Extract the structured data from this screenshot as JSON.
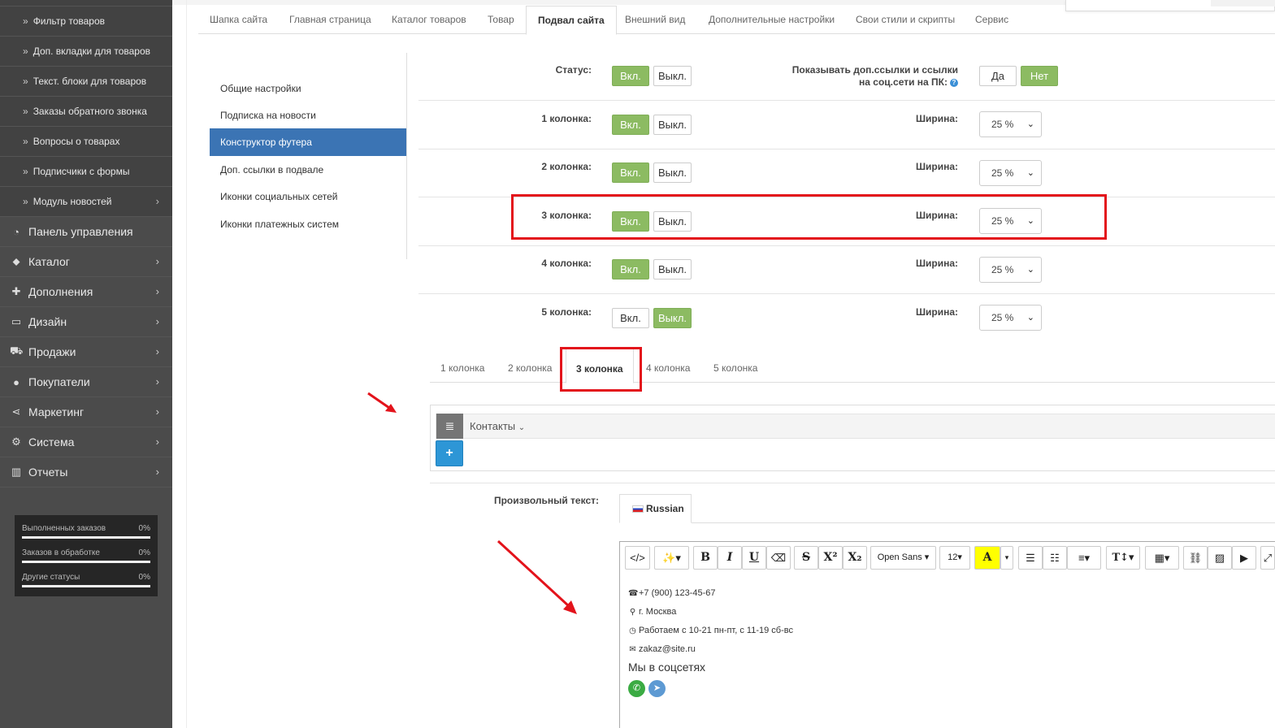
{
  "sidebar": {
    "sub_items": [
      {
        "label": "Фильтр товаров"
      },
      {
        "label": "Доп. вкладки для товаров"
      },
      {
        "label": "Текст. блоки для товаров"
      },
      {
        "label": "Заказы обратного звонка"
      },
      {
        "label": "Вопросы о товарах"
      },
      {
        "label": "Подписчики с формы"
      },
      {
        "label": "Модуль новостей"
      }
    ],
    "main_items": [
      {
        "label": "Панель управления",
        "icon": "dashboard-icon"
      },
      {
        "label": "Каталог",
        "icon": "tag-icon"
      },
      {
        "label": "Дополнения",
        "icon": "puzzle-icon"
      },
      {
        "label": "Дизайн",
        "icon": "desktop-icon"
      },
      {
        "label": "Продажи",
        "icon": "cart-icon"
      },
      {
        "label": "Покупатели",
        "icon": "user-icon"
      },
      {
        "label": "Маркетинг",
        "icon": "share-icon"
      },
      {
        "label": "Система",
        "icon": "gear-icon"
      },
      {
        "label": "Отчеты",
        "icon": "bar-chart-icon"
      }
    ],
    "stats": [
      {
        "label": "Выполненных заказов",
        "value": "0%"
      },
      {
        "label": "Заказов в обработке",
        "value": "0%"
      },
      {
        "label": "Другие статусы",
        "value": "0%"
      }
    ]
  },
  "top_tabs": [
    {
      "label": "Шапка сайта"
    },
    {
      "label": "Главная страница"
    },
    {
      "label": "Каталог товаров"
    },
    {
      "label": "Товар"
    },
    {
      "label": "Подвал сайта"
    },
    {
      "label": "Внешний вид"
    },
    {
      "label": "Дополнительные настройки"
    },
    {
      "label": "Свои стили и скрипты"
    },
    {
      "label": "Сервис"
    }
  ],
  "submenu": [
    {
      "label": "Общие настройки"
    },
    {
      "label": "Подписка на новости"
    },
    {
      "label": "Конструктор футера"
    },
    {
      "label": "Доп. ссылки в подвале"
    },
    {
      "label": "Иконки социальных сетей"
    },
    {
      "label": "Иконки платежных систем"
    }
  ],
  "settings": {
    "status_label": "Статус:",
    "on_label": "Вкл.",
    "off_label": "Выкл.",
    "show_links_label_1": "Показывать доп.ссылки и ссылки",
    "show_links_label_2": "на соц.сети на ПК:",
    "yes_label": "Да",
    "no_label": "Нет",
    "width_label": "Ширина:",
    "columns": [
      {
        "label": "1 колонка:",
        "enabled": true,
        "width": "25 %"
      },
      {
        "label": "2 колонка:",
        "enabled": true,
        "width": "25 %"
      },
      {
        "label": "3 колонка:",
        "enabled": true,
        "width": "25 %"
      },
      {
        "label": "4 колонка:",
        "enabled": true,
        "width": "25 %"
      },
      {
        "label": "5 колонка:",
        "enabled": false,
        "width": "25 %"
      }
    ]
  },
  "column_tabs": [
    {
      "label": "1 колонка"
    },
    {
      "label": "2 колонка"
    },
    {
      "label": "3 колонка"
    },
    {
      "label": "4 колонка"
    },
    {
      "label": "5 колонка"
    }
  ],
  "blocks": {
    "title": "Контакты",
    "add_label": "+"
  },
  "custom_text": {
    "label": "Произвольный текст:",
    "lang_tab": "Russian"
  },
  "editor": {
    "font_name": "Open Sans",
    "font_size": "12",
    "lines": [
      {
        "icon": "phone-icon",
        "text": "+7 (900) 123-45-67"
      },
      {
        "icon": "map-marker-icon",
        "text": "г. Москва"
      },
      {
        "icon": "clock-icon",
        "text": "Работаем с 10-21 пн-пт, с 11-19 сб-вс"
      },
      {
        "icon": "envelope-icon",
        "text": "zakaz@site.ru"
      }
    ],
    "social_heading": "Мы в соцсетях"
  },
  "colors": {
    "accent_green": "#8cbb62",
    "active_blue": "#3b74b4",
    "highlight_red": "#e3131b",
    "add_button_blue": "#2d96d6"
  }
}
